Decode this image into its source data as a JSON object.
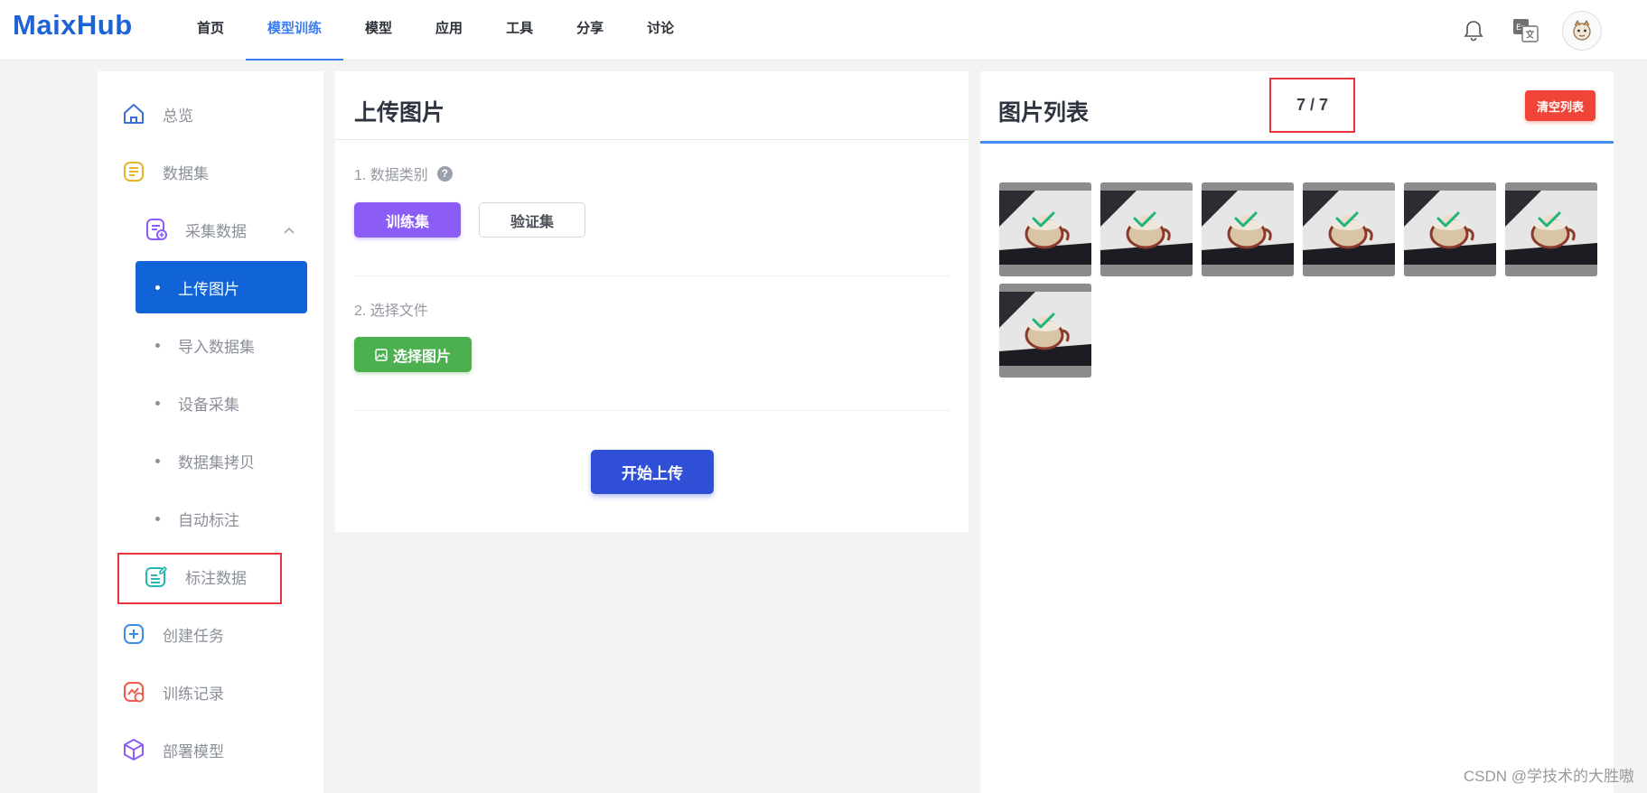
{
  "app": {
    "logo": "MaixHub",
    "nav": [
      "首页",
      "模型训练",
      "模型",
      "应用",
      "工具",
      "分享",
      "讨论"
    ],
    "active_nav": "模型训练"
  },
  "sidebar": {
    "overview": "总览",
    "dataset": "数据集",
    "collect": "采集数据",
    "sub": [
      "上传图片",
      "导入数据集",
      "设备采集",
      "数据集拷贝",
      "自动标注"
    ],
    "label_data": "标注数据",
    "create_task": "创建任务",
    "train_record": "训练记录",
    "deploy": "部署模型"
  },
  "upload": {
    "title": "上传图片",
    "step1": "1. 数据类别",
    "help": "?",
    "train_btn": "训练集",
    "val_btn": "验证集",
    "step2": "2. 选择文件",
    "choose_btn": "选择图片",
    "start_btn": "开始上传"
  },
  "list": {
    "title": "图片列表",
    "counter": "7 / 7",
    "clear_btn": "清空列表",
    "image_count": 7
  },
  "watermark": "CSDN @学技术的大胜嗷",
  "colors": {
    "brand": "#1e63d6",
    "active_nav": "#3a7df0",
    "sidebar_active": "#1064d8",
    "train_btn": "#8b5cf6",
    "choose_btn": "#4cb050",
    "start_btn": "#2f4fd6",
    "clear_btn": "#f04438",
    "highlight_box": "#e8343b"
  }
}
